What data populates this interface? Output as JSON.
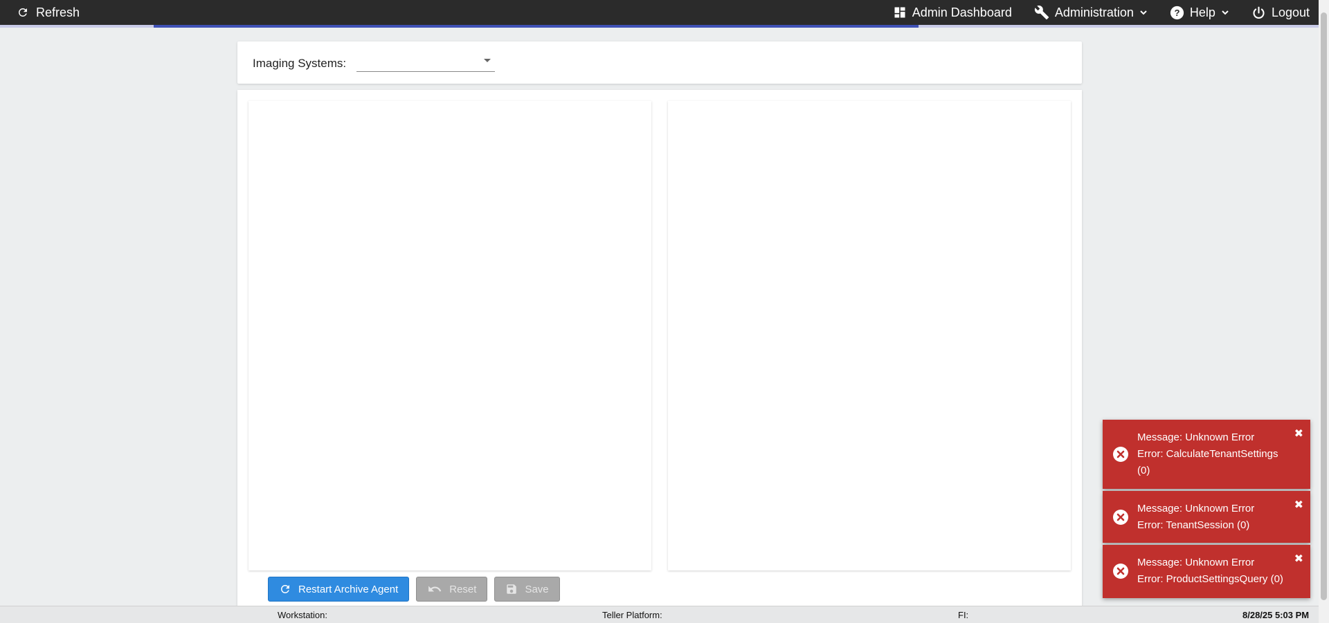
{
  "topbar": {
    "refresh_label": "Refresh",
    "nav": {
      "admin_dashboard": "Admin Dashboard",
      "administration": "Administration",
      "help": "Help",
      "logout": "Logout"
    }
  },
  "loading_progress": 0.58,
  "filter": {
    "label": "Imaging Systems:",
    "value": ""
  },
  "actions": {
    "restart": "Restart Archive Agent",
    "reset": "Reset",
    "save": "Save"
  },
  "statusbar": {
    "workstation": "Workstation:",
    "teller_platform": "Teller Platform:",
    "fi": "FI:",
    "datetime": "8/28/25 5:03 PM"
  },
  "toasts": [
    {
      "line1": "Message: Unknown Error",
      "line2": "Error: CalculateTenantSettings (0)"
    },
    {
      "line1": "Message: Unknown Error",
      "line2": "Error: TenantSession (0)"
    },
    {
      "line1": "Message: Unknown Error",
      "line2": "Error: ProductSettingsQuery (0)"
    }
  ],
  "colors": {
    "topbar": "#2b2b2b",
    "accent": "#3f51b5",
    "primary_button": "#2f8be0",
    "error_toast": "#c0302d"
  },
  "icons": {
    "refresh": "refresh-icon",
    "dashboard": "dashboard-icon",
    "administration": "wrench-icon",
    "help": "help-circle-icon",
    "logout": "power-icon",
    "toast": "error-circle-icon",
    "toast_close": "close-icon",
    "save": "floppy-disk-icon",
    "reset": "undo-icon"
  }
}
